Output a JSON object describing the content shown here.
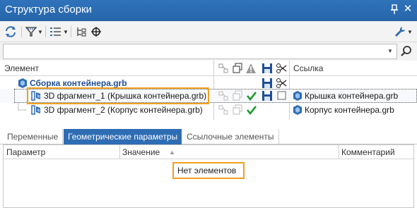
{
  "window": {
    "title": "Структура сборки"
  },
  "tree": {
    "columns": {
      "element": "Элемент",
      "reference": "Ссылка"
    },
    "rows": [
      {
        "label": "Сборка контейнера.grb",
        "reference": ""
      },
      {
        "label": "3D фрагмент_1 (Крышка контейнера.grb)",
        "reference": "Крышка контейнера.grb"
      },
      {
        "label": "3D фрагмент_2 (Корпус контейнера.grb)",
        "reference": "Корпус контейнера.grb"
      }
    ]
  },
  "tabs": [
    {
      "label": "Переменные"
    },
    {
      "label": "Геометрические параметры"
    },
    {
      "label": "Ссылочные элементы"
    }
  ],
  "params_table": {
    "columns": {
      "parameter": "Параметр",
      "value": "Значение",
      "comment": "Комментарий"
    },
    "empty_text": "Нет элементов"
  },
  "colors": {
    "accent": "#2e6db3",
    "highlight": "#f0a020",
    "check": "#1a9a2a"
  }
}
